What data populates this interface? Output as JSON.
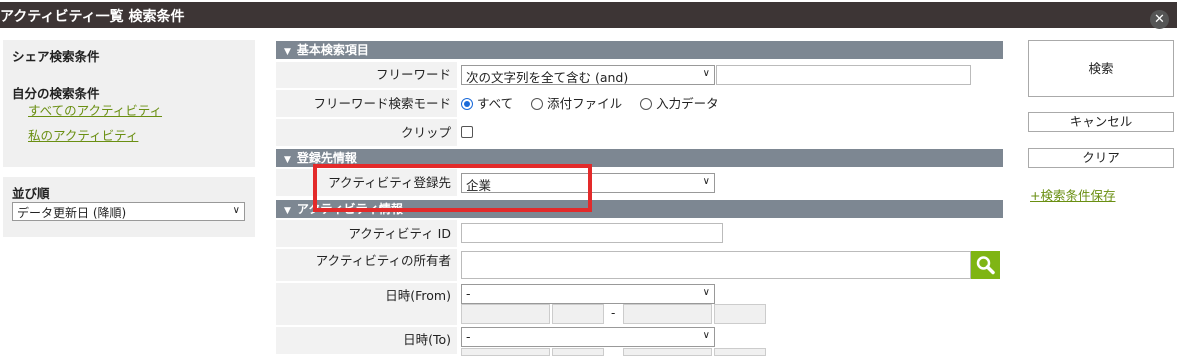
{
  "window": {
    "title": "アクティビティ一覧 検索条件",
    "close_icon": "close-icon"
  },
  "sidebar": {
    "shared_conditions": "シェア検索条件",
    "my_conditions": "自分の検索条件",
    "links": [
      "すべてのアクティビティ",
      "私のアクティビティ"
    ],
    "sort_label": "並び順",
    "sort_value": "データ更新日 (降順)"
  },
  "sections": {
    "basic": "基本検索項目",
    "registration": "登録先情報",
    "activity": "アクティビティ情報"
  },
  "fields": {
    "freeword_label": "フリーワード",
    "freeword_mode_value": "次の文字列を全て含む (and)",
    "freeword_search_mode_label": "フリーワード検索モード",
    "search_mode_options": [
      "すべて",
      "添付ファイル",
      "入力データ"
    ],
    "search_mode_selected": "すべて",
    "clip_label": "クリップ",
    "registration_label": "アクティビティ登録先",
    "registration_value": "企業",
    "activity_id_label": "アクティビティ ID",
    "owner_label": "アクティビティの所有者",
    "from_label": "日時(From)",
    "from_value": "-",
    "to_label": "日時(To)",
    "to_value": "-",
    "date_separator": "-"
  },
  "buttons": {
    "search": "検索",
    "cancel": "キャンセル",
    "clear": "クリア",
    "save_conditions": "+検索条件保存"
  },
  "colors": {
    "accent_green": "#7fb514",
    "section_bar": "#7d8792",
    "highlight": "#e32a2a",
    "titlebar": "#3d3535"
  }
}
